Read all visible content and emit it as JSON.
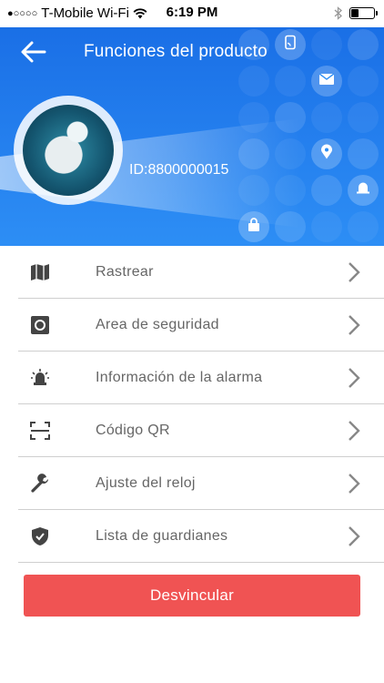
{
  "status_bar": {
    "signal": "●○○○○",
    "carrier": "T-Mobile Wi-Fi",
    "time": "6:19 PM",
    "battery_level": 0.35
  },
  "header": {
    "title": "Funciones del producto",
    "device_id": "ID:8800000015",
    "color": "#1a6fe6"
  },
  "menu": {
    "items": [
      {
        "label": "Rastrear",
        "icon": "map-icon"
      },
      {
        "label": "Area de seguridad",
        "icon": "safe-zone-icon"
      },
      {
        "label": "Información de la alarma",
        "icon": "alarm-light-icon"
      },
      {
        "label": "Código QR",
        "icon": "qr-scan-icon"
      },
      {
        "label": "Ajuste del reloj",
        "icon": "wrench-icon"
      },
      {
        "label": "Lista de guardianes",
        "icon": "shield-icon"
      }
    ]
  },
  "actions": {
    "unlink_label": "Desvincular",
    "unlink_color": "#f05353"
  }
}
